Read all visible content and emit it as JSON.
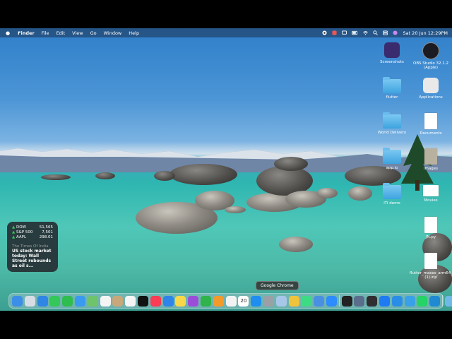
{
  "menubar": {
    "apple": "",
    "app_name": "Finder",
    "menus": [
      "File",
      "Edit",
      "View",
      "Go",
      "Window",
      "Help"
    ],
    "clock": "Sat 20 Jun  12:29PM"
  },
  "desktop_icons": [
    {
      "label": "Screenshots",
      "kind": "app",
      "color": "#3a2a6e"
    },
    {
      "label": "OBS Studio 32.1.2 (Apple)",
      "kind": "app",
      "color": "#1b1b24"
    },
    {
      "label": "flutter",
      "kind": "folder"
    },
    {
      "label": "Applications",
      "kind": "app",
      "color": "#e9e9e9"
    },
    {
      "label": "World Delivery",
      "kind": "folder"
    },
    {
      "label": "Documents",
      "kind": "doc"
    },
    {
      "label": "app.io",
      "kind": "folder"
    },
    {
      "label": "images",
      "kind": "doc"
    },
    {
      "label": "iTi demo",
      "kind": "folder"
    },
    {
      "label": "Movies",
      "kind": "doc"
    },
    {
      "label": "JN.py",
      "kind": "doc"
    },
    {
      "label": "flutter_macos_arm64_3_..._le (1).zip",
      "kind": "doc"
    }
  ],
  "widget": {
    "stocks": [
      {
        "symbol": "DOW",
        "value": "51,565"
      },
      {
        "symbol": "S&P 500",
        "value": "7,501"
      },
      {
        "symbol": "AAPL",
        "value": "298.01"
      }
    ],
    "news_source": "The Times Of India",
    "news_headline": "US stock market today: Wall Street rebounds as oil s..."
  },
  "dock": {
    "tooltip": "Google Chrome",
    "calendar_day": "20",
    "apps": [
      {
        "name": "finder",
        "color": "#3b8fe8"
      },
      {
        "name": "launchpad",
        "color": "#d8dde5"
      },
      {
        "name": "safari",
        "color": "#2f86e4"
      },
      {
        "name": "messages",
        "color": "#34c759"
      },
      {
        "name": "facetime",
        "color": "#2fbd4f"
      },
      {
        "name": "mail",
        "color": "#3a9af0"
      },
      {
        "name": "maps",
        "color": "#6fc36a"
      },
      {
        "name": "photos",
        "color": "#f4f4f4"
      },
      {
        "name": "contacts",
        "color": "#c8a77b"
      },
      {
        "name": "reminders",
        "color": "#f5f5f5"
      },
      {
        "name": "apple-tv",
        "color": "#111111"
      },
      {
        "name": "music",
        "color": "#fa3c55"
      },
      {
        "name": "keynote",
        "color": "#2e84e8"
      },
      {
        "name": "notes",
        "color": "#f7d84a"
      },
      {
        "name": "podcasts",
        "color": "#9b4dd9"
      },
      {
        "name": "numbers",
        "color": "#2fb34a"
      },
      {
        "name": "pages",
        "color": "#f39a2b"
      },
      {
        "name": "freeform",
        "color": "#f2f2f2"
      },
      {
        "name": "calendar",
        "color": "#ffffff"
      },
      {
        "name": "app-store",
        "color": "#1e8ff0"
      },
      {
        "name": "system-settings",
        "color": "#9aa0a6"
      },
      {
        "name": "preview",
        "color": "#a7c7e8"
      },
      {
        "name": "google-chrome",
        "color": "#f0c43a"
      },
      {
        "name": "android-studio",
        "color": "#3ddc84"
      },
      {
        "name": "xcode-cloud",
        "color": "#4a90e2"
      },
      {
        "name": "zoom",
        "color": "#2d8cff"
      },
      {
        "name": "terminal",
        "color": "#222222"
      },
      {
        "name": "simulator",
        "color": "#5a6e8c"
      },
      {
        "name": "obs-studio",
        "color": "#302e31"
      },
      {
        "name": "xcode",
        "color": "#1f7bf2"
      },
      {
        "name": "docker",
        "color": "#2b8ee6"
      },
      {
        "name": "quicktime",
        "color": "#3aa0e8"
      },
      {
        "name": "whatsapp",
        "color": "#25d366"
      },
      {
        "name": "vscode",
        "color": "#1f8ad2"
      },
      {
        "name": "downloads-stack",
        "color": "#6fb9e8"
      },
      {
        "name": "trash",
        "color": "#d9dde2"
      }
    ]
  }
}
